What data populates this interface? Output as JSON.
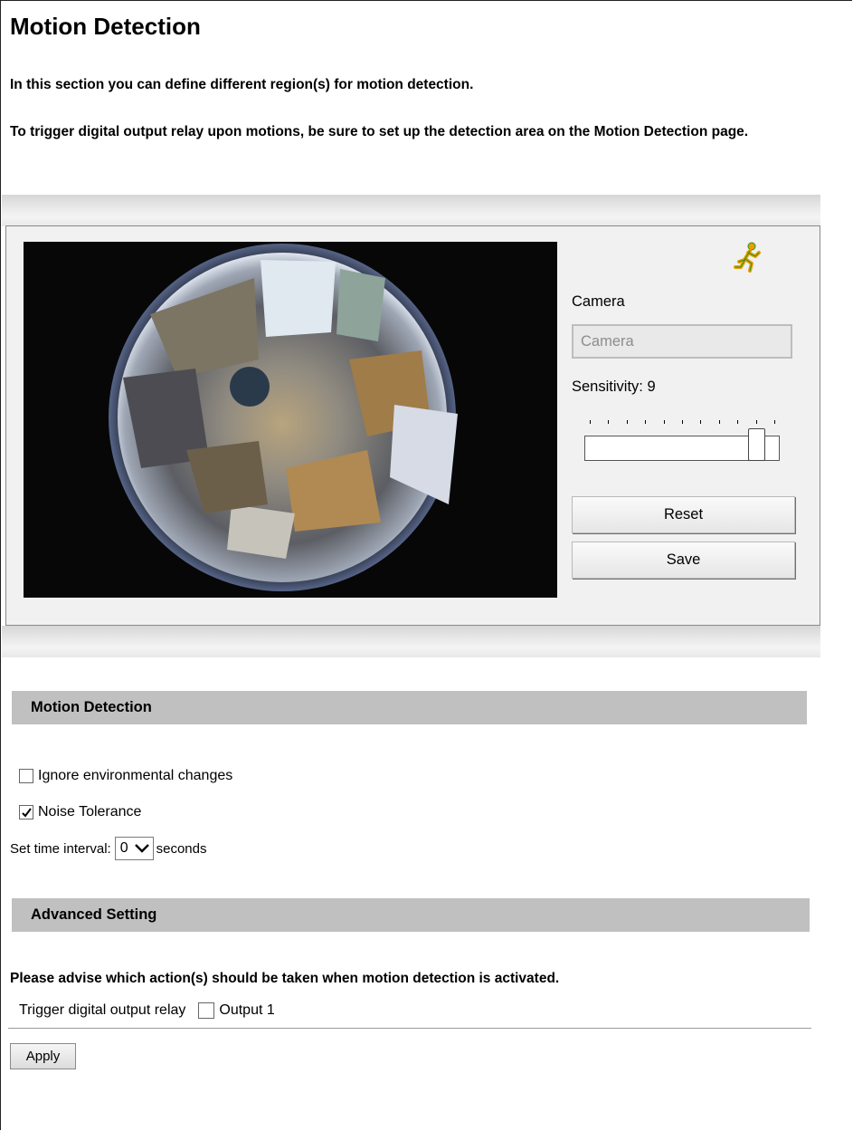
{
  "page": {
    "title": "Motion Detection",
    "intro1": "In this section you can define different region(s) for motion detection.",
    "intro2": "To trigger digital output relay upon motions, be sure to set up the detection area on the Motion Detection page."
  },
  "viewer": {
    "motion_icon": "running-man-icon",
    "camera_label": "Camera",
    "camera_field": {
      "value": "Camera",
      "placeholder": "Camera"
    },
    "sensitivity_label": "Sensitivity: 9",
    "sensitivity": {
      "value": 9,
      "min": 0,
      "max": 10
    },
    "reset_label": "Reset",
    "save_label": "Save"
  },
  "motion_detection": {
    "header": "Motion Detection",
    "ignore_env": {
      "label": "Ignore environmental changes",
      "checked": false
    },
    "noise_tolerance": {
      "label": "Noise Tolerance",
      "checked": true
    },
    "interval_label": "Set time interval:",
    "interval_value": "0",
    "interval_unit": "seconds"
  },
  "advanced": {
    "header": "Advanced Setting",
    "prompt": "Please advise which action(s) should be taken when motion detection is activated.",
    "relay_label": "Trigger digital output relay",
    "output1": {
      "label": "Output 1",
      "checked": false
    }
  },
  "apply_label": "Apply",
  "colors": {
    "section_bar": "#c0c0c0",
    "panel_bg": "#f1f1f1",
    "icon_orange": "#e8a000",
    "icon_green": "#2f8f1f"
  }
}
